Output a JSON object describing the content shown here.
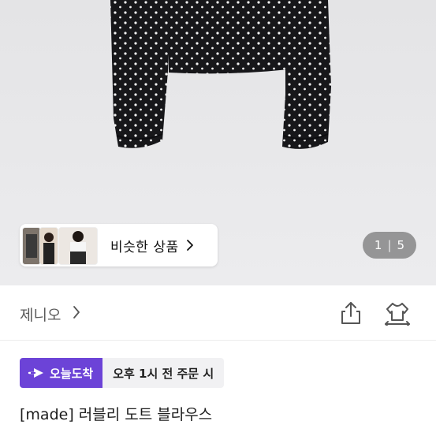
{
  "similar": {
    "label": "비슷한 상품"
  },
  "gallery": {
    "current": "1",
    "total": "5"
  },
  "store": {
    "name": "제니오"
  },
  "icons": {
    "share": "share-icon",
    "hanger": "hanger-icon",
    "arrow": "fast-arrow-icon"
  },
  "delivery": {
    "badge_label": "오늘도착",
    "cutoff_text": "오후 1시 전 주문 시"
  },
  "product": {
    "title": "[made] 러블리 도트 블라우스"
  },
  "colors": {
    "accent": "#6c43d7",
    "hero_bg": "#e9e9eb",
    "garment": "#17171a"
  }
}
